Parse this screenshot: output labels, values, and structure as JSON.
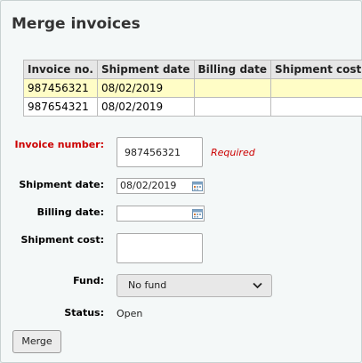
{
  "page": {
    "title": "Merge invoices"
  },
  "table": {
    "headers": [
      "Invoice no.",
      "Shipment date",
      "Billing date",
      "Shipment cost"
    ],
    "rows": [
      [
        "987456321",
        "08/02/2019",
        "",
        ""
      ],
      [
        "987654321",
        "08/02/2019",
        "",
        ""
      ]
    ]
  },
  "form": {
    "invoice_number": {
      "label": "Invoice number:",
      "value": "987456321",
      "required_text": "Required"
    },
    "shipment_date": {
      "label": "Shipment date:",
      "value": "08/02/2019"
    },
    "billing_date": {
      "label": "Billing date:",
      "value": ""
    },
    "shipment_cost": {
      "label": "Shipment cost:",
      "value": ""
    },
    "fund": {
      "label": "Fund:",
      "selected": "No fund"
    },
    "status": {
      "label": "Status:",
      "value": "Open"
    },
    "merge_button": "Merge"
  },
  "icons": {
    "calendar": "calendar-icon",
    "dropdown": "chevron-down-icon"
  },
  "colors": {
    "required": "#cc0000",
    "highlight_row": "#fffdc6",
    "header_bg": "#e6e6e6"
  }
}
